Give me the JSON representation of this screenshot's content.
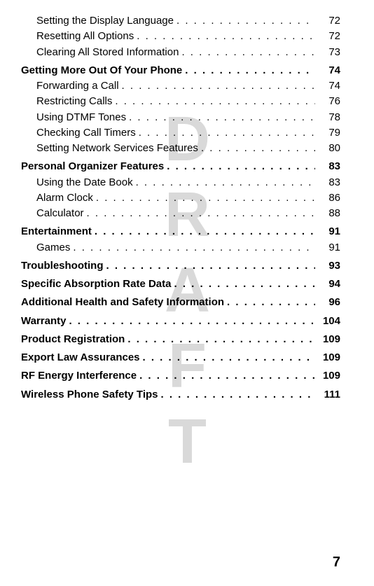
{
  "watermark": "DRAFT",
  "pageNumber": "7",
  "toc": [
    {
      "type": "sub",
      "label": "Setting the Display Language",
      "page": "72"
    },
    {
      "type": "sub",
      "label": "Resetting All Options",
      "page": "72"
    },
    {
      "type": "sub",
      "label": "Clearing All Stored Information",
      "page": "73"
    },
    {
      "type": "chap",
      "label": "Getting More Out Of Your Phone",
      "page": "74"
    },
    {
      "type": "sub",
      "label": "Forwarding a Call",
      "page": "74"
    },
    {
      "type": "sub",
      "label": "Restricting Calls",
      "page": "76"
    },
    {
      "type": "sub",
      "label": "Using DTMF Tones",
      "page": "78"
    },
    {
      "type": "sub",
      "label": "Checking Call Timers",
      "page": "79"
    },
    {
      "type": "sub",
      "label": "Setting Network Services Features",
      "page": "80"
    },
    {
      "type": "chap",
      "label": "Personal Organizer Features",
      "page": "83"
    },
    {
      "type": "sub",
      "label": "Using the Date Book",
      "page": "83"
    },
    {
      "type": "sub",
      "label": "Alarm Clock",
      "page": "86"
    },
    {
      "type": "sub",
      "label": "Calculator",
      "page": "88"
    },
    {
      "type": "chap",
      "label": "Entertainment",
      "page": "91"
    },
    {
      "type": "sub",
      "label": "Games",
      "page": "91"
    },
    {
      "type": "chap",
      "label": "Troubleshooting",
      "page": "93"
    },
    {
      "type": "chap",
      "label": "Specific Absorption Rate Data",
      "page": "94"
    },
    {
      "type": "chap",
      "label": "Additional Health and Safety Information",
      "page": "96"
    },
    {
      "type": "chap",
      "label": "Warranty",
      "page": "104"
    },
    {
      "type": "chap",
      "label": "Product Registration",
      "page": "109"
    },
    {
      "type": "chap",
      "label": "Export Law Assurances",
      "page": "109"
    },
    {
      "type": "chap",
      "label": "RF Energy Interference",
      "page": "109"
    },
    {
      "type": "chap",
      "label": "Wireless Phone Safety Tips",
      "page": "111"
    }
  ]
}
